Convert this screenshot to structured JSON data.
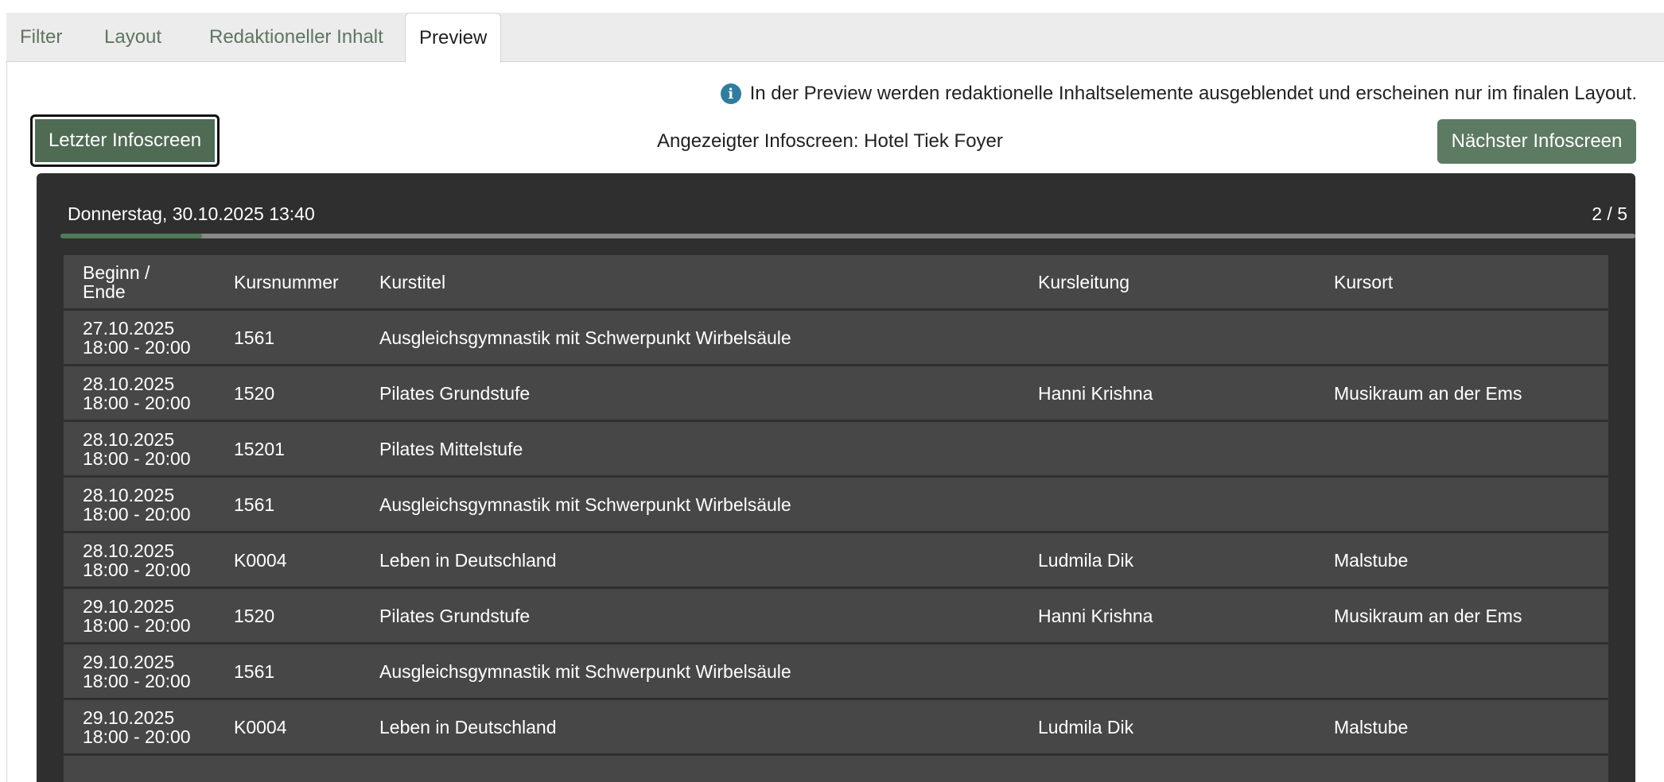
{
  "tabs": [
    {
      "label": "Filter",
      "active": false
    },
    {
      "label": "Layout",
      "active": false
    },
    {
      "label": "Redaktioneller Inhalt",
      "active": false
    },
    {
      "label": "Preview",
      "active": true
    }
  ],
  "info": {
    "icon": "info-icon",
    "text": "In der Preview werden redaktionelle Inhaltselemente ausgeblendet und erscheinen nur im finalen Layout."
  },
  "nav": {
    "prev_label": "Letzter Infoscreen",
    "current_label": "Angezeigter Infoscreen: Hotel Tiek Foyer",
    "next_label": "Nächster Infoscreen"
  },
  "screen": {
    "datetime": "Donnerstag, 30.10.2025 13:40",
    "page": "2 / 5",
    "progress_fraction": 0.09
  },
  "table": {
    "headers": {
      "date": "Beginn /",
      "date2": "Ende",
      "number": "Kursnummer",
      "title": "Kurstitel",
      "lead": "Kursleitung",
      "place": "Kursort"
    },
    "rows": [
      {
        "date": "27.10.2025",
        "time": "18:00 - 20:00",
        "number": "1561",
        "title": "Ausgleichsgymnastik mit Schwerpunkt Wirbelsäule",
        "lead": "",
        "place": ""
      },
      {
        "date": "28.10.2025",
        "time": "18:00 - 20:00",
        "number": "1520",
        "title": "Pilates Grundstufe",
        "lead": "Hanni Krishna",
        "place": "Musikraum an der Ems"
      },
      {
        "date": "28.10.2025",
        "time": "18:00 - 20:00",
        "number": "15201",
        "title": "Pilates Mittelstufe",
        "lead": "",
        "place": ""
      },
      {
        "date": "28.10.2025",
        "time": "18:00 - 20:00",
        "number": "1561",
        "title": "Ausgleichsgymnastik mit Schwerpunkt Wirbelsäule",
        "lead": "",
        "place": ""
      },
      {
        "date": "28.10.2025",
        "time": "18:00 - 20:00",
        "number": "K0004",
        "title": "Leben in Deutschland",
        "lead": "Ludmila Dik",
        "place": "Malstube"
      },
      {
        "date": "29.10.2025",
        "time": "18:00 - 20:00",
        "number": "1520",
        "title": "Pilates Grundstufe",
        "lead": "Hanni Krishna",
        "place": "Musikraum an der Ems"
      },
      {
        "date": "29.10.2025",
        "time": "18:00 - 20:00",
        "number": "1561",
        "title": "Ausgleichsgymnastik mit Schwerpunkt Wirbelsäule",
        "lead": "",
        "place": ""
      },
      {
        "date": "29.10.2025",
        "time": "18:00 - 20:00",
        "number": "K0004",
        "title": "Leben in Deutschland",
        "lead": "Ludmila Dik",
        "place": "Malstube"
      },
      {
        "date": "",
        "time": "",
        "number": "",
        "title": "",
        "lead": "",
        "place": ""
      }
    ]
  }
}
